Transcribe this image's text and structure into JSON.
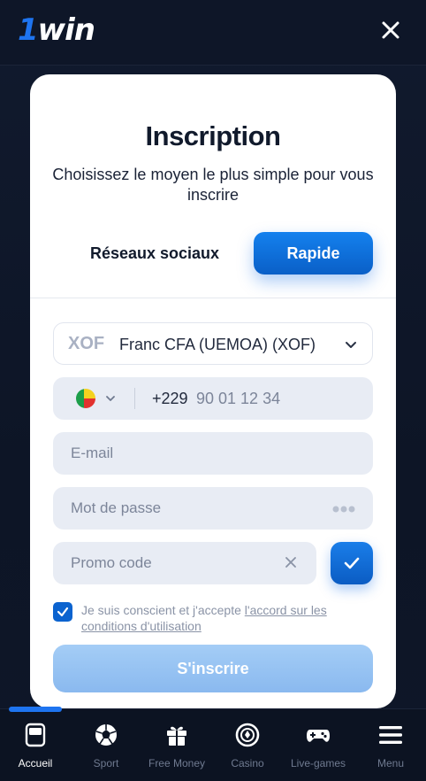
{
  "header": {
    "logo_prefix": "1",
    "logo_text": "win",
    "close_label": "Close"
  },
  "modal": {
    "title": "Inscription",
    "subtitle": "Choisissez le moyen le plus simple pour vous inscrire",
    "modes": {
      "social": "Réseaux sociaux",
      "quick": "Rapide",
      "selected": "Rapide"
    },
    "currency": {
      "code": "XOF",
      "name": "Franc CFA (UEMOA) (XOF)"
    },
    "phone": {
      "prefix": "+229",
      "placeholder": "90 01 12 34",
      "flag_icon": "benin-flag-icon"
    },
    "email": {
      "placeholder": "E-mail"
    },
    "password": {
      "placeholder": "Mot de passe"
    },
    "promo": {
      "placeholder": "Promo code"
    },
    "terms": {
      "checked": true,
      "text_before": "Je suis conscient et j'accepte ",
      "link_text": "l'accord sur les conditions d'utilisation"
    },
    "submit_label": "S'inscrire"
  },
  "bottom_nav": {
    "items": [
      {
        "label": "Accueil",
        "icon": "home-icon",
        "active": true
      },
      {
        "label": "Sport",
        "icon": "soccer-ball-icon",
        "active": false
      },
      {
        "label": "Free Money",
        "icon": "gift-icon",
        "active": false
      },
      {
        "label": "Casino",
        "icon": "casino-chip-icon",
        "active": false
      },
      {
        "label": "Live-games",
        "icon": "gamepad-icon",
        "active": false
      },
      {
        "label": "Menu",
        "icon": "hamburger-menu-icon",
        "active": false
      }
    ]
  },
  "colors": {
    "brand_blue": "#1e74f0",
    "modal_bg": "#ffffff",
    "page_bg": "#0b1224",
    "input_bg": "#e8ecf4"
  }
}
